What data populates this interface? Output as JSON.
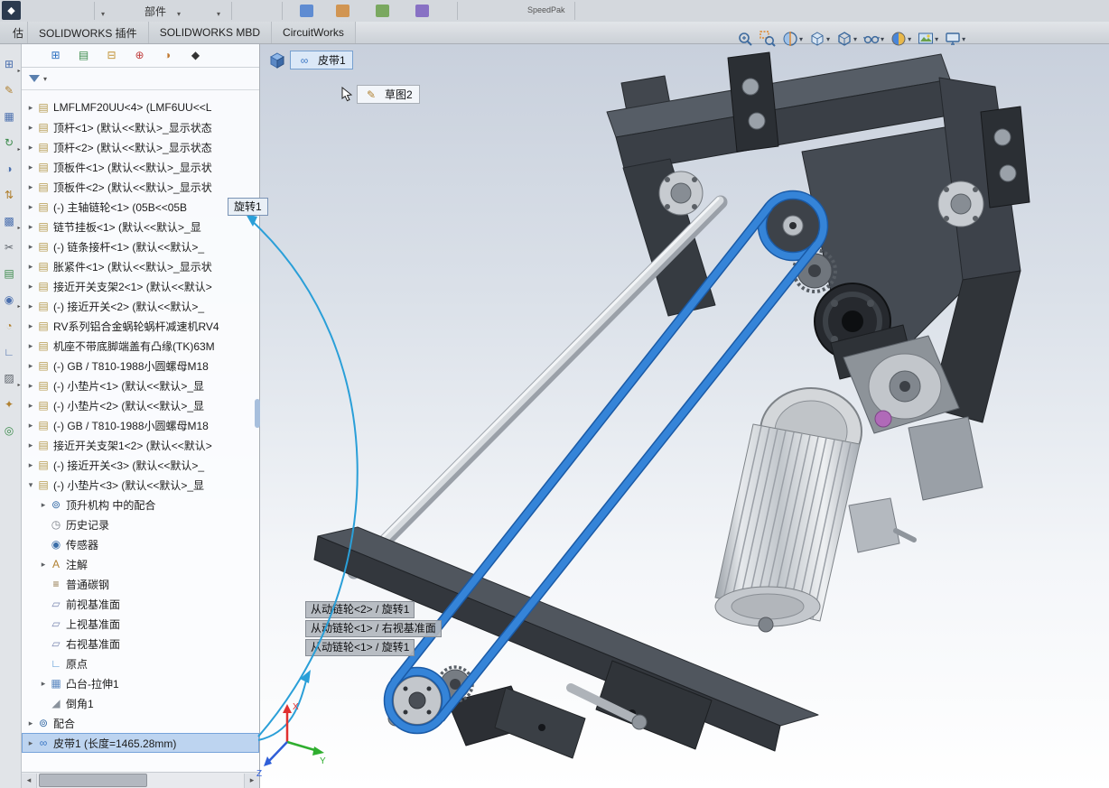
{
  "colors": {
    "selection": "#bdd4f0",
    "belt_highlight": "#3584d8",
    "leader_blue": "#2a9fd8",
    "accent_tab": "#d4d8dd"
  },
  "ribbon": {
    "partial_label_1": "部件",
    "partial_label_2": "SpeedPak"
  },
  "tabs": {
    "partial": "估",
    "items": [
      "SOLIDWORKS 插件",
      "SOLIDWORKS MBD",
      "CircuitWorks"
    ]
  },
  "panel_tabs": [
    {
      "name": "featuremanager-tree-icon"
    },
    {
      "name": "propertymanager-icon"
    },
    {
      "name": "configurationmanager-icon"
    },
    {
      "name": "dimxpertmanager-icon"
    },
    {
      "name": "displaymanager-icon"
    },
    {
      "name": "cam-manager-icon"
    }
  ],
  "left_toolbar": [
    {
      "name": "copy-icon",
      "caret": true
    },
    {
      "name": "pencil-icon",
      "caret": false
    },
    {
      "name": "grid-icon",
      "caret": false
    },
    {
      "name": "rotate-icon",
      "caret": true
    },
    {
      "name": "half-shade-icon",
      "caret": false
    },
    {
      "name": "swap-icon",
      "caret": false
    },
    {
      "name": "pattern-icon",
      "caret": true
    },
    {
      "name": "scissors-icon",
      "caret": false
    },
    {
      "name": "rows-icon",
      "caret": false
    },
    {
      "name": "circle-dot-icon",
      "caret": true
    },
    {
      "name": "quarter-icon",
      "caret": false
    },
    {
      "name": "angle-icon",
      "caret": false
    },
    {
      "name": "shade-icon",
      "caret": true
    },
    {
      "name": "star-icon",
      "caret": false
    },
    {
      "name": "target-icon",
      "caret": false
    }
  ],
  "headsup": [
    {
      "name": "zoom-fit-icon",
      "caret": false
    },
    {
      "name": "zoom-area-icon",
      "caret": false
    },
    {
      "name": "section-view-icon",
      "caret": true
    },
    {
      "name": "view-orientation-icon",
      "caret": true
    },
    {
      "name": "display-style-icon",
      "caret": true
    },
    {
      "name": "hide-show-items-icon",
      "caret": true
    },
    {
      "name": "edit-appearance-icon",
      "caret": true
    },
    {
      "name": "apply-scene-icon",
      "caret": true
    },
    {
      "name": "view-settings-icon",
      "caret": true
    }
  ],
  "tree": {
    "items": [
      {
        "label": "LMFLMF20UU<4> (LMF6UU<<L",
        "level": 0,
        "arrow": "collapsed",
        "icon": "part-icon"
      },
      {
        "label": "顶杆<1> (默认<<默认>_显示状态",
        "level": 0,
        "arrow": "collapsed",
        "icon": "part-icon"
      },
      {
        "label": "顶杆<2> (默认<<默认>_显示状态",
        "level": 0,
        "arrow": "collapsed",
        "icon": "part-icon"
      },
      {
        "label": "顶板件<1> (默认<<默认>_显示状",
        "level": 0,
        "arrow": "collapsed",
        "icon": "part-icon"
      },
      {
        "label": "顶板件<2> (默认<<默认>_显示状",
        "level": 0,
        "arrow": "collapsed",
        "icon": "part-icon"
      },
      {
        "label": "(-) 主轴链轮<1> (05B<<05B",
        "level": 0,
        "arrow": "collapsed",
        "icon": "part-icon"
      },
      {
        "label": "链节挂板<1> (默认<<默认>_显",
        "level": 0,
        "arrow": "collapsed",
        "icon": "part-icon"
      },
      {
        "label": "(-) 链条接杆<1> (默认<<默认>_",
        "level": 0,
        "arrow": "collapsed",
        "icon": "part-icon"
      },
      {
        "label": "胀紧件<1> (默认<<默认>_显示状",
        "level": 0,
        "arrow": "collapsed",
        "icon": "part-icon"
      },
      {
        "label": "接近开关支架2<1> (默认<<默认>",
        "level": 0,
        "arrow": "collapsed",
        "icon": "part-icon"
      },
      {
        "label": "(-) 接近开关<2> (默认<<默认>_",
        "level": 0,
        "arrow": "collapsed",
        "icon": "part-icon"
      },
      {
        "label": "RV系列铝合金蜗轮蜗杆减速机RV4",
        "level": 0,
        "arrow": "collapsed",
        "icon": "part-icon"
      },
      {
        "label": "机座不带底脚端盖有凸缘(TK)63M",
        "level": 0,
        "arrow": "collapsed",
        "icon": "part-icon"
      },
      {
        "label": "(-) GB / T810-1988小圆螺母M18",
        "level": 0,
        "arrow": "collapsed",
        "icon": "part-icon"
      },
      {
        "label": "(-) 小垫片<1> (默认<<默认>_显",
        "level": 0,
        "arrow": "collapsed",
        "icon": "part-icon"
      },
      {
        "label": "(-) 小垫片<2> (默认<<默认>_显",
        "level": 0,
        "arrow": "collapsed",
        "icon": "part-icon"
      },
      {
        "label": "(-) GB / T810-1988小圆螺母M18",
        "level": 0,
        "arrow": "collapsed",
        "icon": "part-icon"
      },
      {
        "label": "接近开关支架1<2> (默认<<默认>",
        "level": 0,
        "arrow": "collapsed",
        "icon": "part-icon"
      },
      {
        "label": "(-) 接近开关<3> (默认<<默认>_",
        "level": 0,
        "arrow": "collapsed",
        "icon": "part-icon"
      },
      {
        "label": "(-) 小垫片<3> (默认<<默认>_显",
        "level": 0,
        "arrow": "expanded",
        "icon": "part-icon"
      },
      {
        "label": "顶升机构 中的配合",
        "level": 1,
        "arrow": "collapsed",
        "icon": "mates-folder-icon"
      },
      {
        "label": "历史记录",
        "level": 1,
        "arrow": "none",
        "icon": "history-icon"
      },
      {
        "label": "传感器",
        "level": 1,
        "arrow": "none",
        "icon": "sensors-icon"
      },
      {
        "label": "注解",
        "level": 1,
        "arrow": "collapsed",
        "icon": "annotations-icon"
      },
      {
        "label": "普通碳钢",
        "level": 1,
        "arrow": "none",
        "icon": "material-icon"
      },
      {
        "label": "前视基准面",
        "level": 1,
        "arrow": "none",
        "icon": "plane-icon"
      },
      {
        "label": "上视基准面",
        "level": 1,
        "arrow": "none",
        "icon": "plane-icon"
      },
      {
        "label": "右视基准面",
        "level": 1,
        "arrow": "none",
        "icon": "plane-icon"
      },
      {
        "label": "原点",
        "level": 1,
        "arrow": "none",
        "icon": "origin-icon"
      },
      {
        "label": "凸台-拉伸1",
        "level": 1,
        "arrow": "collapsed",
        "icon": "extrude-icon"
      },
      {
        "label": "倒角1",
        "level": 1,
        "arrow": "none",
        "icon": "chamfer-icon"
      },
      {
        "label": "配合",
        "level": 0,
        "arrow": "collapsed",
        "icon": "mates-folder-icon"
      },
      {
        "label": "皮带1 (长度=1465.28mm)",
        "level": 0,
        "arrow": "collapsed",
        "icon": "belt-icon",
        "selected": true
      }
    ]
  },
  "viewport": {
    "breadcrumb": {
      "item": "皮带1",
      "sub_item": "草图2"
    },
    "mate_tooltip": "旋转1",
    "callouts": [
      "从动链轮<2> / 旋转1",
      "从动链轮<1> / 右视基准面",
      "从动链轮<1> / 旋转1"
    ],
    "triad": {
      "x": "X",
      "y": "Y",
      "z": "Z"
    }
  }
}
